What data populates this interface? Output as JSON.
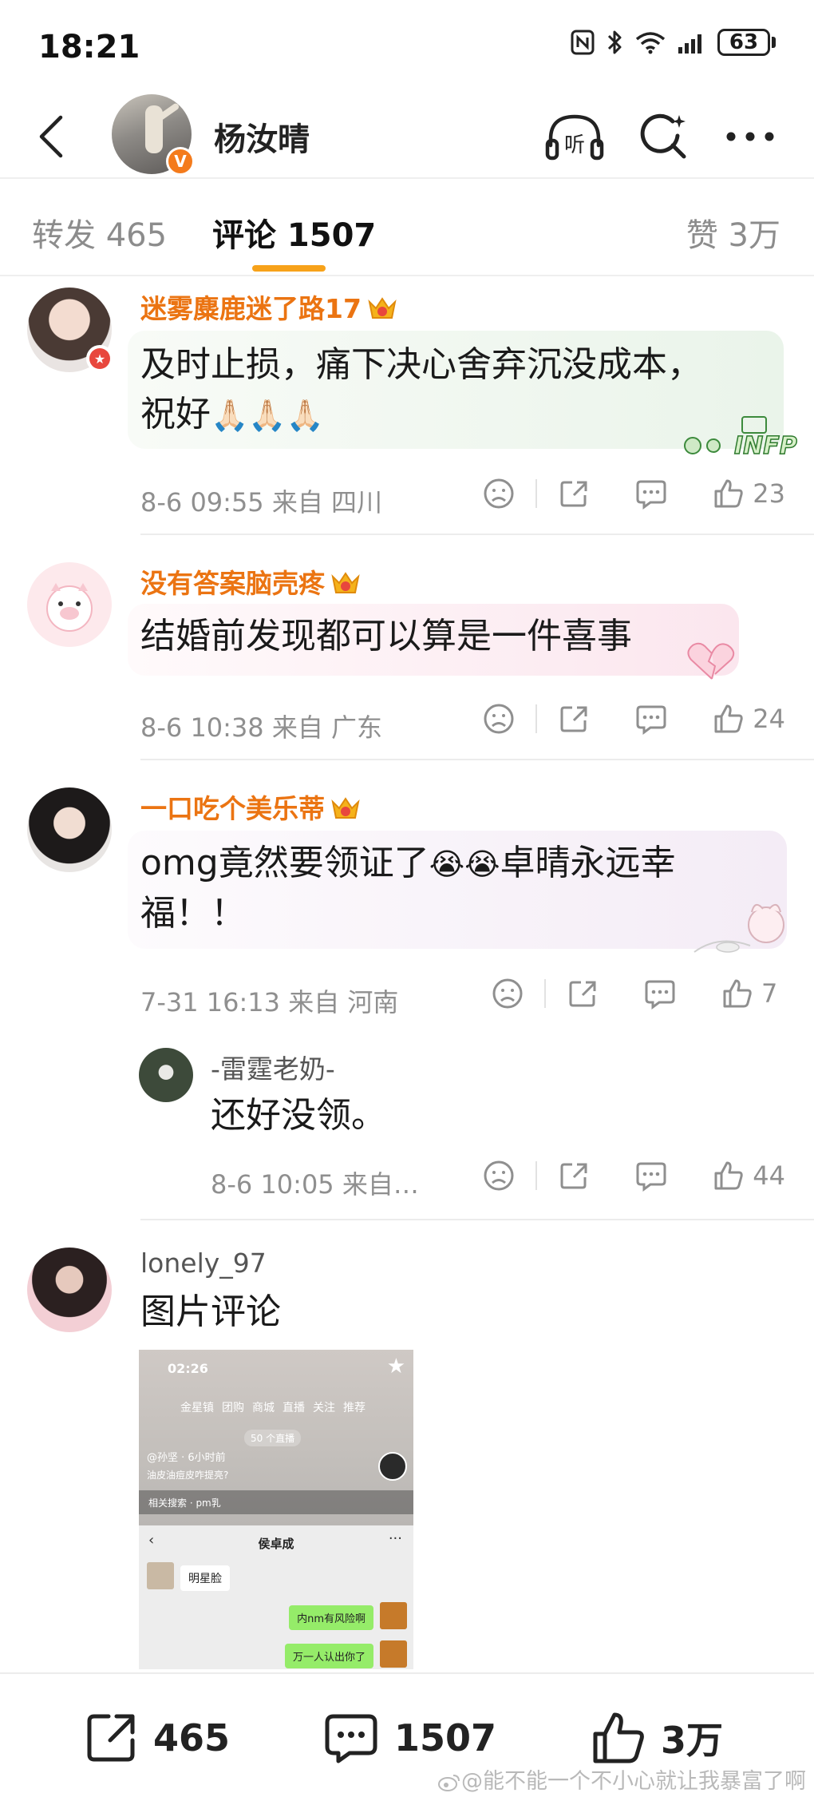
{
  "status_bar": {
    "time": "18:21",
    "battery": "63",
    "icons": [
      "nfc-icon",
      "bluetooth-icon",
      "wifi-icon",
      "signal-icon",
      "battery-icon"
    ]
  },
  "header": {
    "user_name": "杨汝晴",
    "verified_badge": "V",
    "listen_label": "听"
  },
  "tabs": {
    "repost": "转发 465",
    "comment": "评论 1507",
    "like": "赞 3万",
    "active": "comment",
    "accent_color": "#f7a21a"
  },
  "comments": [
    {
      "name": "迷雾麋鹿迷了路17",
      "vip_level": "6",
      "text_line1": "及时止损，痛下决心舍弃沉没成本，",
      "text_line2": "祝好",
      "emojis": "🙏🏻🙏🏻🙏🏻",
      "sticker_text": "INFP",
      "meta": "8-6 09:55  来自 四川",
      "likes": "23"
    },
    {
      "name": "没有答案脑壳疼",
      "vip_level": "2",
      "text_line1": "结婚前发现都可以算是一件喜事",
      "meta": "8-6 10:38  来自 广东",
      "likes": "24"
    },
    {
      "name": "一口吃个美乐蒂",
      "vip_level": "6",
      "text_line1_a": "omg竟然要领证了",
      "emojis": "😭😭",
      "text_line1_b": "卓晴永远幸",
      "text_line2": "福！！",
      "meta": "7-31 16:13  来自 河南",
      "likes": "7"
    },
    {
      "name": "-雷霆老奶-",
      "text_line1": "还好没领。",
      "meta": "8-6 10:05  来自…",
      "likes": "44"
    },
    {
      "name": "lonely_97",
      "text_line1": "图片评论"
    }
  ],
  "picture": {
    "time": "02:26",
    "tabs": [
      "金星镇",
      "团购",
      "商城",
      "直播",
      "关注",
      "推荐"
    ],
    "live_badge": "50 个直播",
    "user": "@孙坚 · 6小时前",
    "desc": "油皮油痘皮咋提亮?",
    "search": "相关搜索 · pm乳",
    "chat_title": "侯卓成",
    "msg_left": "明星脸",
    "msg_right_1": "内nm有风险啊",
    "msg_right_2": "万一人认出你了"
  },
  "bottom_bar": {
    "repost_count": "465",
    "comment_count": "1507",
    "like_count": "3万"
  },
  "watermark": "@能不能一个不小心就让我暴富了啊"
}
